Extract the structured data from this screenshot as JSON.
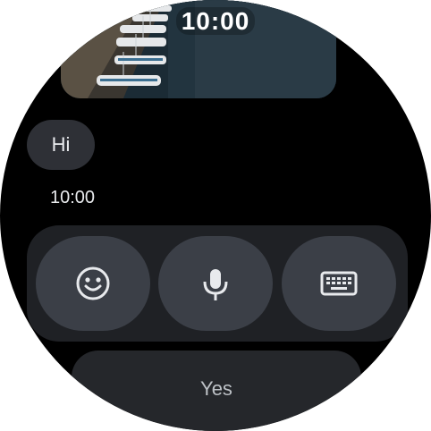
{
  "status": {
    "time": "10:00"
  },
  "conversation": {
    "message_text": "Hi",
    "message_time": "10:00"
  },
  "input_bar": {
    "emoji_icon": "smile-icon",
    "voice_icon": "microphone-icon",
    "keyboard_icon": "keyboard-icon"
  },
  "suggested_replies": [
    {
      "label": "Yes"
    }
  ],
  "colors": {
    "background": "#000000",
    "bubble": "#2e3036",
    "button": "#3b3f47",
    "text": "#e8eaed"
  }
}
